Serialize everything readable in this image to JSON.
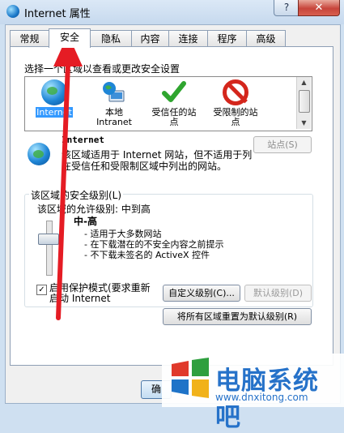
{
  "window": {
    "title": "Internet 属性",
    "help_label": "?",
    "close_label": "✕"
  },
  "tabs": [
    {
      "label": "常规"
    },
    {
      "label": "安全"
    },
    {
      "label": "隐私"
    },
    {
      "label": "内容"
    },
    {
      "label": "连接"
    },
    {
      "label": "程序"
    },
    {
      "label": "高级"
    }
  ],
  "active_tab": "安全",
  "zones": {
    "prompt": "选择一个区域以查看或更改安全设置",
    "items": [
      {
        "label": "Internet",
        "icon": "globe-icon",
        "selected": true
      },
      {
        "label": "本地\nIntranet",
        "icon": "intranet-icon"
      },
      {
        "label": "受信任的站\n点",
        "icon": "check-icon"
      },
      {
        "label": "受限制的站\n点",
        "icon": "no-entry-icon"
      }
    ]
  },
  "selected_zone": {
    "name": "Internet",
    "description": "该区域适用于 Internet 网站，但不适用于列在受信任和受限制区域中列出的网站。",
    "sites_button": "站点(S)"
  },
  "security_level": {
    "group_label": "该区域的安全级别(L)",
    "allowed_levels": "该区域的允许级别: 中到高",
    "level_name": "中-高",
    "bullets": [
      "适用于大多数网站",
      "在下载潜在的不安全内容之前提示",
      "不下载未签名的 ActiveX 控件"
    ],
    "protected_mode_label": "启用保护模式(要求重新\n启动 Internet",
    "protected_mode_checked": true,
    "custom_level_button": "自定义级别(C)...",
    "default_level_button": "默认级别(D)",
    "reset_all_button": "将所有区域重置为默认级别(R)"
  },
  "footer": {
    "ok_label": "确"
  },
  "watermark": {
    "text": "电脑系统吧",
    "url": "www.dnxitong.com"
  },
  "colors": {
    "selection": "#3399ff",
    "arrow": "#e51c24",
    "watermark": "#2672c9"
  }
}
